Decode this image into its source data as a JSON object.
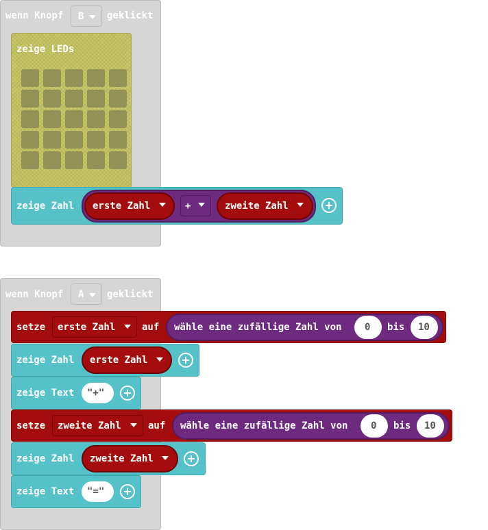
{
  "event_b": {
    "when_label": "wenn Knopf",
    "button": "B",
    "clicked_label": "geklickt",
    "show_leds_label": "zeige LEDs",
    "show_number_label": "zeige Zahl",
    "left_var": "erste Zahl",
    "operator": "+",
    "right_var": "zweite Zahl"
  },
  "event_a": {
    "when_label": "wenn Knopf",
    "button": "A",
    "clicked_label": "geklickt",
    "statements": [
      {
        "type": "set",
        "set_label": "setze",
        "var": "erste Zahl",
        "to_label": "auf",
        "random_label": "wähle eine zufällige Zahl von",
        "from": "0",
        "to_word": "bis",
        "to": "10"
      },
      {
        "type": "show_number",
        "label": "zeige Zahl",
        "var": "erste Zahl"
      },
      {
        "type": "show_text",
        "label": "zeige Text",
        "text": "\"+\""
      },
      {
        "type": "set",
        "set_label": "setze",
        "var": "zweite Zahl",
        "to_label": "auf",
        "random_label": "wähle eine zufällige Zahl von",
        "from": "0",
        "to_word": "bis",
        "to": "10"
      },
      {
        "type": "show_number",
        "label": "zeige Zahl",
        "var": "zweite Zahl"
      },
      {
        "type": "show_text",
        "label": "zeige Text",
        "text": "\"=\""
      }
    ]
  },
  "colors": {
    "event": "#d6d6d6",
    "basic": "#55c2c9",
    "variables": "#a40d0d",
    "math": "#6e2a7e",
    "leds": "#c8c760"
  },
  "icons": {
    "dropdown": "chevron-down-icon",
    "add": "plus-circle-icon"
  }
}
